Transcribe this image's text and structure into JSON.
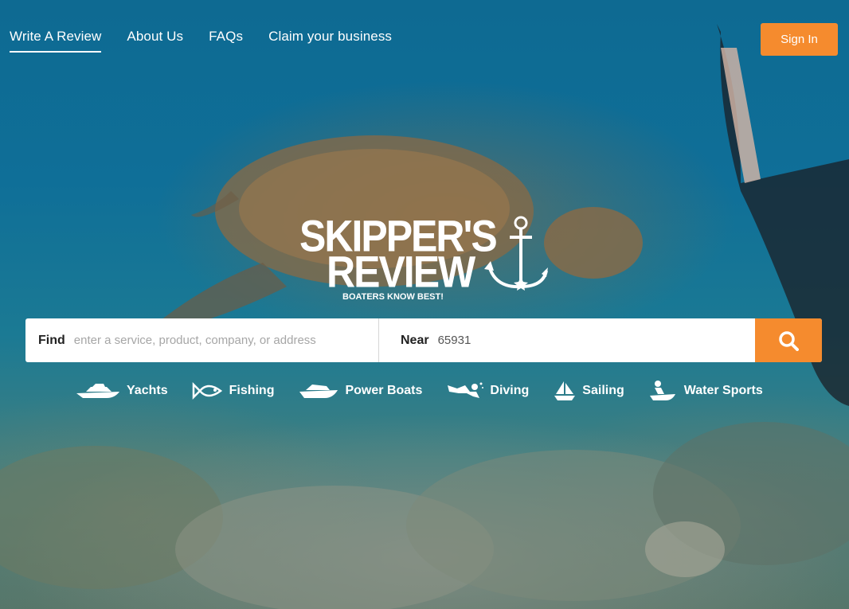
{
  "nav": {
    "items": [
      {
        "label": "Write A Review"
      },
      {
        "label": "About Us"
      },
      {
        "label": "FAQs"
      },
      {
        "label": "Claim your business"
      }
    ],
    "sign_in_label": "Sign In"
  },
  "logo": {
    "line1": "SKIPPER'S",
    "line2": "REVIEW",
    "tagline": "BOATERS KNOW BEST!",
    "icon": "anchor-icon"
  },
  "search": {
    "find_label": "Find",
    "find_placeholder": "enter a service, product, company, or address",
    "find_value": "",
    "near_label": "Near",
    "near_value": "65931",
    "button_icon": "search-icon"
  },
  "categories": [
    {
      "label": "Yachts",
      "icon": "yacht-icon"
    },
    {
      "label": "Fishing",
      "icon": "fish-icon"
    },
    {
      "label": "Power Boats",
      "icon": "power-boat-icon"
    },
    {
      "label": "Diving",
      "icon": "diver-icon"
    },
    {
      "label": "Sailing",
      "icon": "sailboat-icon"
    },
    {
      "label": "Water Sports",
      "icon": "jet-ski-icon"
    }
  ],
  "colors": {
    "accent": "#f58b2e",
    "text_on_hero": "#ffffff"
  }
}
